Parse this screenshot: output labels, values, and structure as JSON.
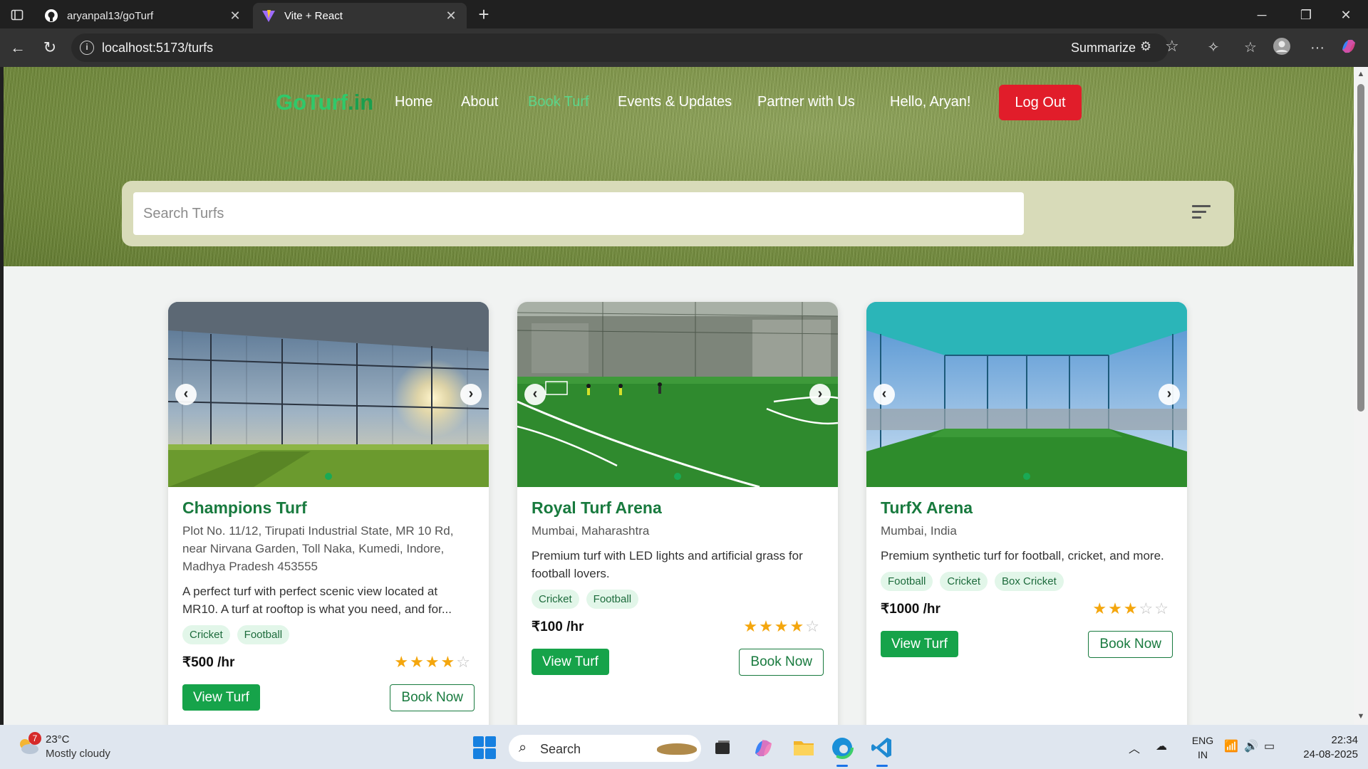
{
  "browser": {
    "tabs": [
      {
        "label": "aryanpal13/goTurf",
        "icon": "github-icon"
      },
      {
        "label": "Vite + React",
        "icon": "vite-icon"
      }
    ],
    "url": "localhost:5173/turfs",
    "summarize_label": "Summarize"
  },
  "nav": {
    "logo_main": "GoTurf",
    "logo_suffix": ".in",
    "links": [
      "Home",
      "About",
      "Book Turf",
      "Events & Updates",
      "Partner with Us"
    ],
    "active_link": "Book Turf",
    "greeting": "Hello, Aryan!",
    "logout_label": "Log Out"
  },
  "search": {
    "placeholder": "Search Turfs"
  },
  "turfs": [
    {
      "name": "Champions Turf",
      "address": "Plot No. 11/12, Tirupati Industrial State, MR 10 Rd, near Nirvana Garden, Toll Naka, Kumedi, Indore, Madhya Pradesh 453555",
      "description": "A perfect turf with perfect scenic view located at MR10. A turf at rooftop is what you need, and for...",
      "tags": [
        "Cricket",
        "Football"
      ],
      "price": "₹500 /hr",
      "rating": 4,
      "view_label": "View Turf",
      "book_label": "Book Now"
    },
    {
      "name": "Royal Turf Arena",
      "address": "Mumbai, Maharashtra",
      "description": "Premium turf with LED lights and artificial grass for football lovers.",
      "tags": [
        "Cricket",
        "Football"
      ],
      "price": "₹100 /hr",
      "rating": 4,
      "view_label": "View Turf",
      "book_label": "Book Now"
    },
    {
      "name": "TurfX Arena",
      "address": "Mumbai, India",
      "description": "Premium synthetic turf for football, cricket, and more.",
      "tags": [
        "Football",
        "Cricket",
        "Box Cricket"
      ],
      "price": "₹1000 /hr",
      "rating": 3,
      "view_label": "View Turf",
      "book_label": "Book Now"
    }
  ],
  "taskbar": {
    "weather_temp": "23°C",
    "weather_desc": "Mostly cloudy",
    "weather_badge": "7",
    "search_label": "Search",
    "lang_1": "ENG",
    "lang_2": "IN",
    "time": "22:34",
    "date": "24-08-2025"
  },
  "colors": {
    "brand_green": "#16a34a",
    "logout_red": "#e11d2a",
    "star": "#f4a60d"
  }
}
